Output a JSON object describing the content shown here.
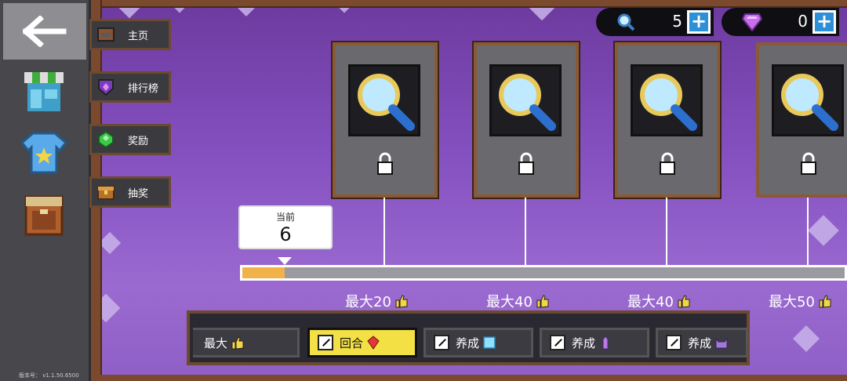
{
  "sidebar": {
    "version": "版本号： v1.1.50.6500"
  },
  "nav": {
    "items": [
      {
        "label": "主页"
      },
      {
        "label": "排行榜"
      },
      {
        "label": "奖励"
      },
      {
        "label": "抽奖"
      }
    ]
  },
  "currency": {
    "magnifier": "5",
    "gems": "0"
  },
  "progress": {
    "current_label": "当前",
    "current_value": "6",
    "fill_fraction": 0.07
  },
  "milestones": [
    {
      "label": "最大20"
    },
    {
      "label": "最大40"
    },
    {
      "label": "最大40"
    },
    {
      "label": "最大50"
    }
  ],
  "filters": [
    {
      "label": "最大"
    },
    {
      "label": "回合"
    },
    {
      "label": "养成"
    },
    {
      "label": "养成"
    },
    {
      "label": "养成"
    }
  ],
  "colors": {
    "accent_yellow": "#f3e045",
    "plus_blue": "#2d8fd8",
    "progress_fill": "#f2b24a"
  }
}
